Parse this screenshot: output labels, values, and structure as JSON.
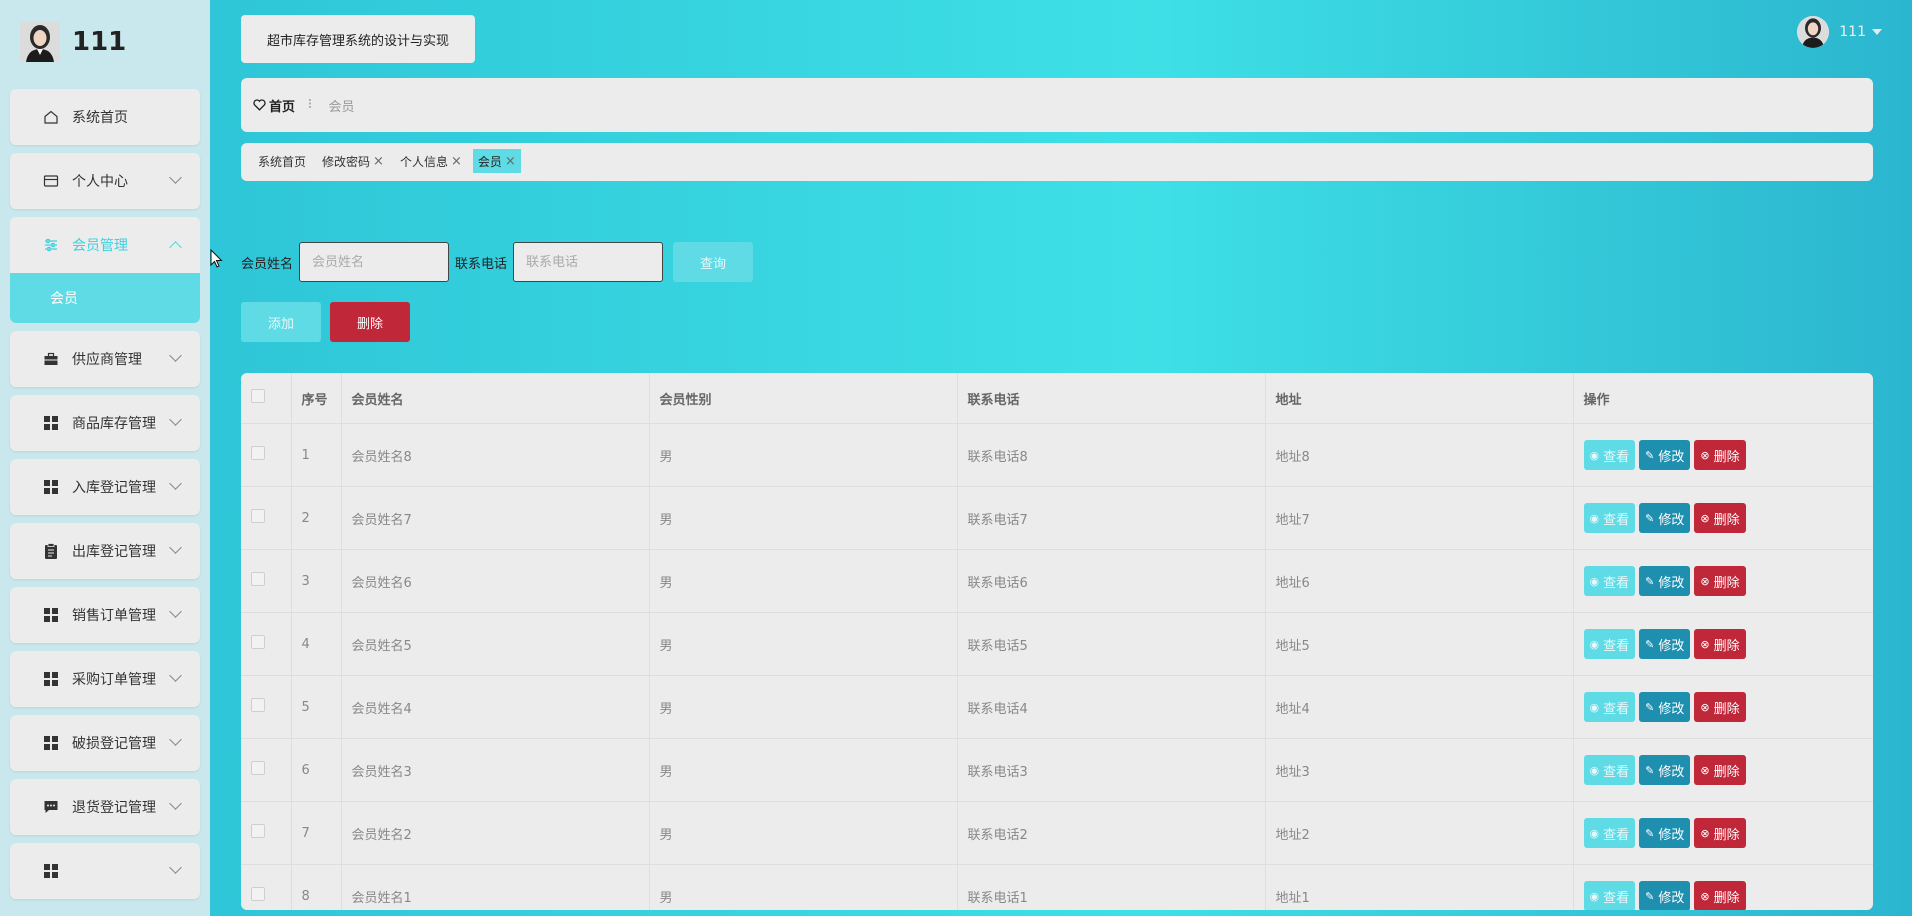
{
  "sidebar": {
    "username": "111",
    "items": [
      {
        "label": "系统首页",
        "icon": "home-icon"
      },
      {
        "label": "个人中心",
        "icon": "card-icon"
      },
      {
        "label": "会员管理",
        "icon": "sliders-icon",
        "sub": [
          "会员"
        ]
      },
      {
        "label": "供应商管理",
        "icon": "briefcase-icon"
      },
      {
        "label": "商品库存管理",
        "icon": "grid-icon"
      },
      {
        "label": "入库登记管理",
        "icon": "grid-icon"
      },
      {
        "label": "出库登记管理",
        "icon": "clipboard-icon"
      },
      {
        "label": "销售订单管理",
        "icon": "grid-icon"
      },
      {
        "label": "采购订单管理",
        "icon": "grid-icon"
      },
      {
        "label": "破损登记管理",
        "icon": "grid-icon"
      },
      {
        "label": "退货登记管理",
        "icon": "chat-icon"
      }
    ]
  },
  "header": {
    "system_title": "超市库存管理系统的设计与实现",
    "user_name": "111"
  },
  "breadcrumb": {
    "home": "首页",
    "current": "会员"
  },
  "tabs": [
    {
      "label": "系统首页",
      "closable": false
    },
    {
      "label": "修改密码",
      "closable": true
    },
    {
      "label": "个人信息",
      "closable": true
    },
    {
      "label": "会员",
      "closable": true,
      "active": true
    }
  ],
  "search": {
    "name_label": "会员姓名",
    "name_placeholder": "会员姓名",
    "phone_label": "联系电话",
    "phone_placeholder": "联系电话",
    "query_label": "查询"
  },
  "actions": {
    "add_label": "添加",
    "delete_label": "删除"
  },
  "table": {
    "columns": [
      "序号",
      "会员姓名",
      "会员性别",
      "联系电话",
      "地址",
      "操作"
    ],
    "rows": [
      {
        "no": "1",
        "name": "会员姓名8",
        "gender": "男",
        "phone": "联系电话8",
        "address": "地址8"
      },
      {
        "no": "2",
        "name": "会员姓名7",
        "gender": "男",
        "phone": "联系电话7",
        "address": "地址7"
      },
      {
        "no": "3",
        "name": "会员姓名6",
        "gender": "男",
        "phone": "联系电话6",
        "address": "地址6"
      },
      {
        "no": "4",
        "name": "会员姓名5",
        "gender": "男",
        "phone": "联系电话5",
        "address": "地址5"
      },
      {
        "no": "5",
        "name": "会员姓名4",
        "gender": "男",
        "phone": "联系电话4",
        "address": "地址4"
      },
      {
        "no": "6",
        "name": "会员姓名3",
        "gender": "男",
        "phone": "联系电话3",
        "address": "地址3"
      },
      {
        "no": "7",
        "name": "会员姓名2",
        "gender": "男",
        "phone": "联系电话2",
        "address": "地址2"
      },
      {
        "no": "8",
        "name": "会员姓名1",
        "gender": "男",
        "phone": "联系电话1",
        "address": "地址1"
      }
    ],
    "row_actions": {
      "view": "查看",
      "edit": "修改",
      "delete": "删除"
    }
  },
  "colors": {
    "accent": "#5fdbe6",
    "danger": "#c0283a",
    "edit": "#1f8fb0"
  }
}
